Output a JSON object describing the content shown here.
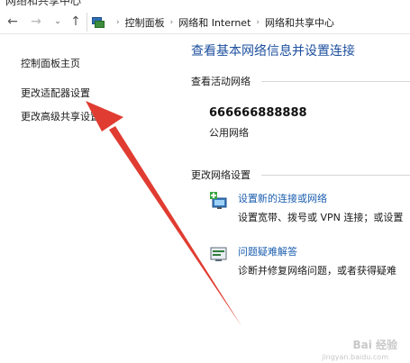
{
  "window": {
    "title": "网络和共享中心"
  },
  "nav": {
    "back_glyph": "←",
    "forward_glyph": "→",
    "recent_glyph": "⌄",
    "up_glyph": "↑"
  },
  "breadcrumb": {
    "separator": "›",
    "items": [
      "控制面板",
      "网络和 Internet",
      "网络和共享中心"
    ]
  },
  "sidebar": {
    "items": [
      {
        "label": "控制面板主页"
      },
      {
        "label": "更改适配器设置"
      },
      {
        "label": "更改高级共享设置"
      }
    ]
  },
  "main": {
    "title": "查看基本网络信息并设置连接",
    "active_networks": {
      "heading": "查看活动网络",
      "network_name": "666666888888",
      "network_type": "公用网络"
    },
    "change_settings": {
      "heading": "更改网络设置",
      "tasks": [
        {
          "link": "设置新的连接或网络",
          "description": "设置宽带、拨号或 VPN 连接；或设置",
          "icon": "new-connection-icon"
        },
        {
          "link": "问题疑难解答",
          "description": "诊断并修复网络问题，或者获得疑难",
          "icon": "troubleshoot-icon"
        }
      ]
    }
  },
  "annotation": {
    "arrow_color": "#e03c31"
  },
  "watermark": {
    "text": "Bai 经验",
    "sub": "jingyan.baidu.com"
  },
  "colors": {
    "link_blue": "#1d5fb0",
    "title_blue": "#1d4f9e"
  }
}
